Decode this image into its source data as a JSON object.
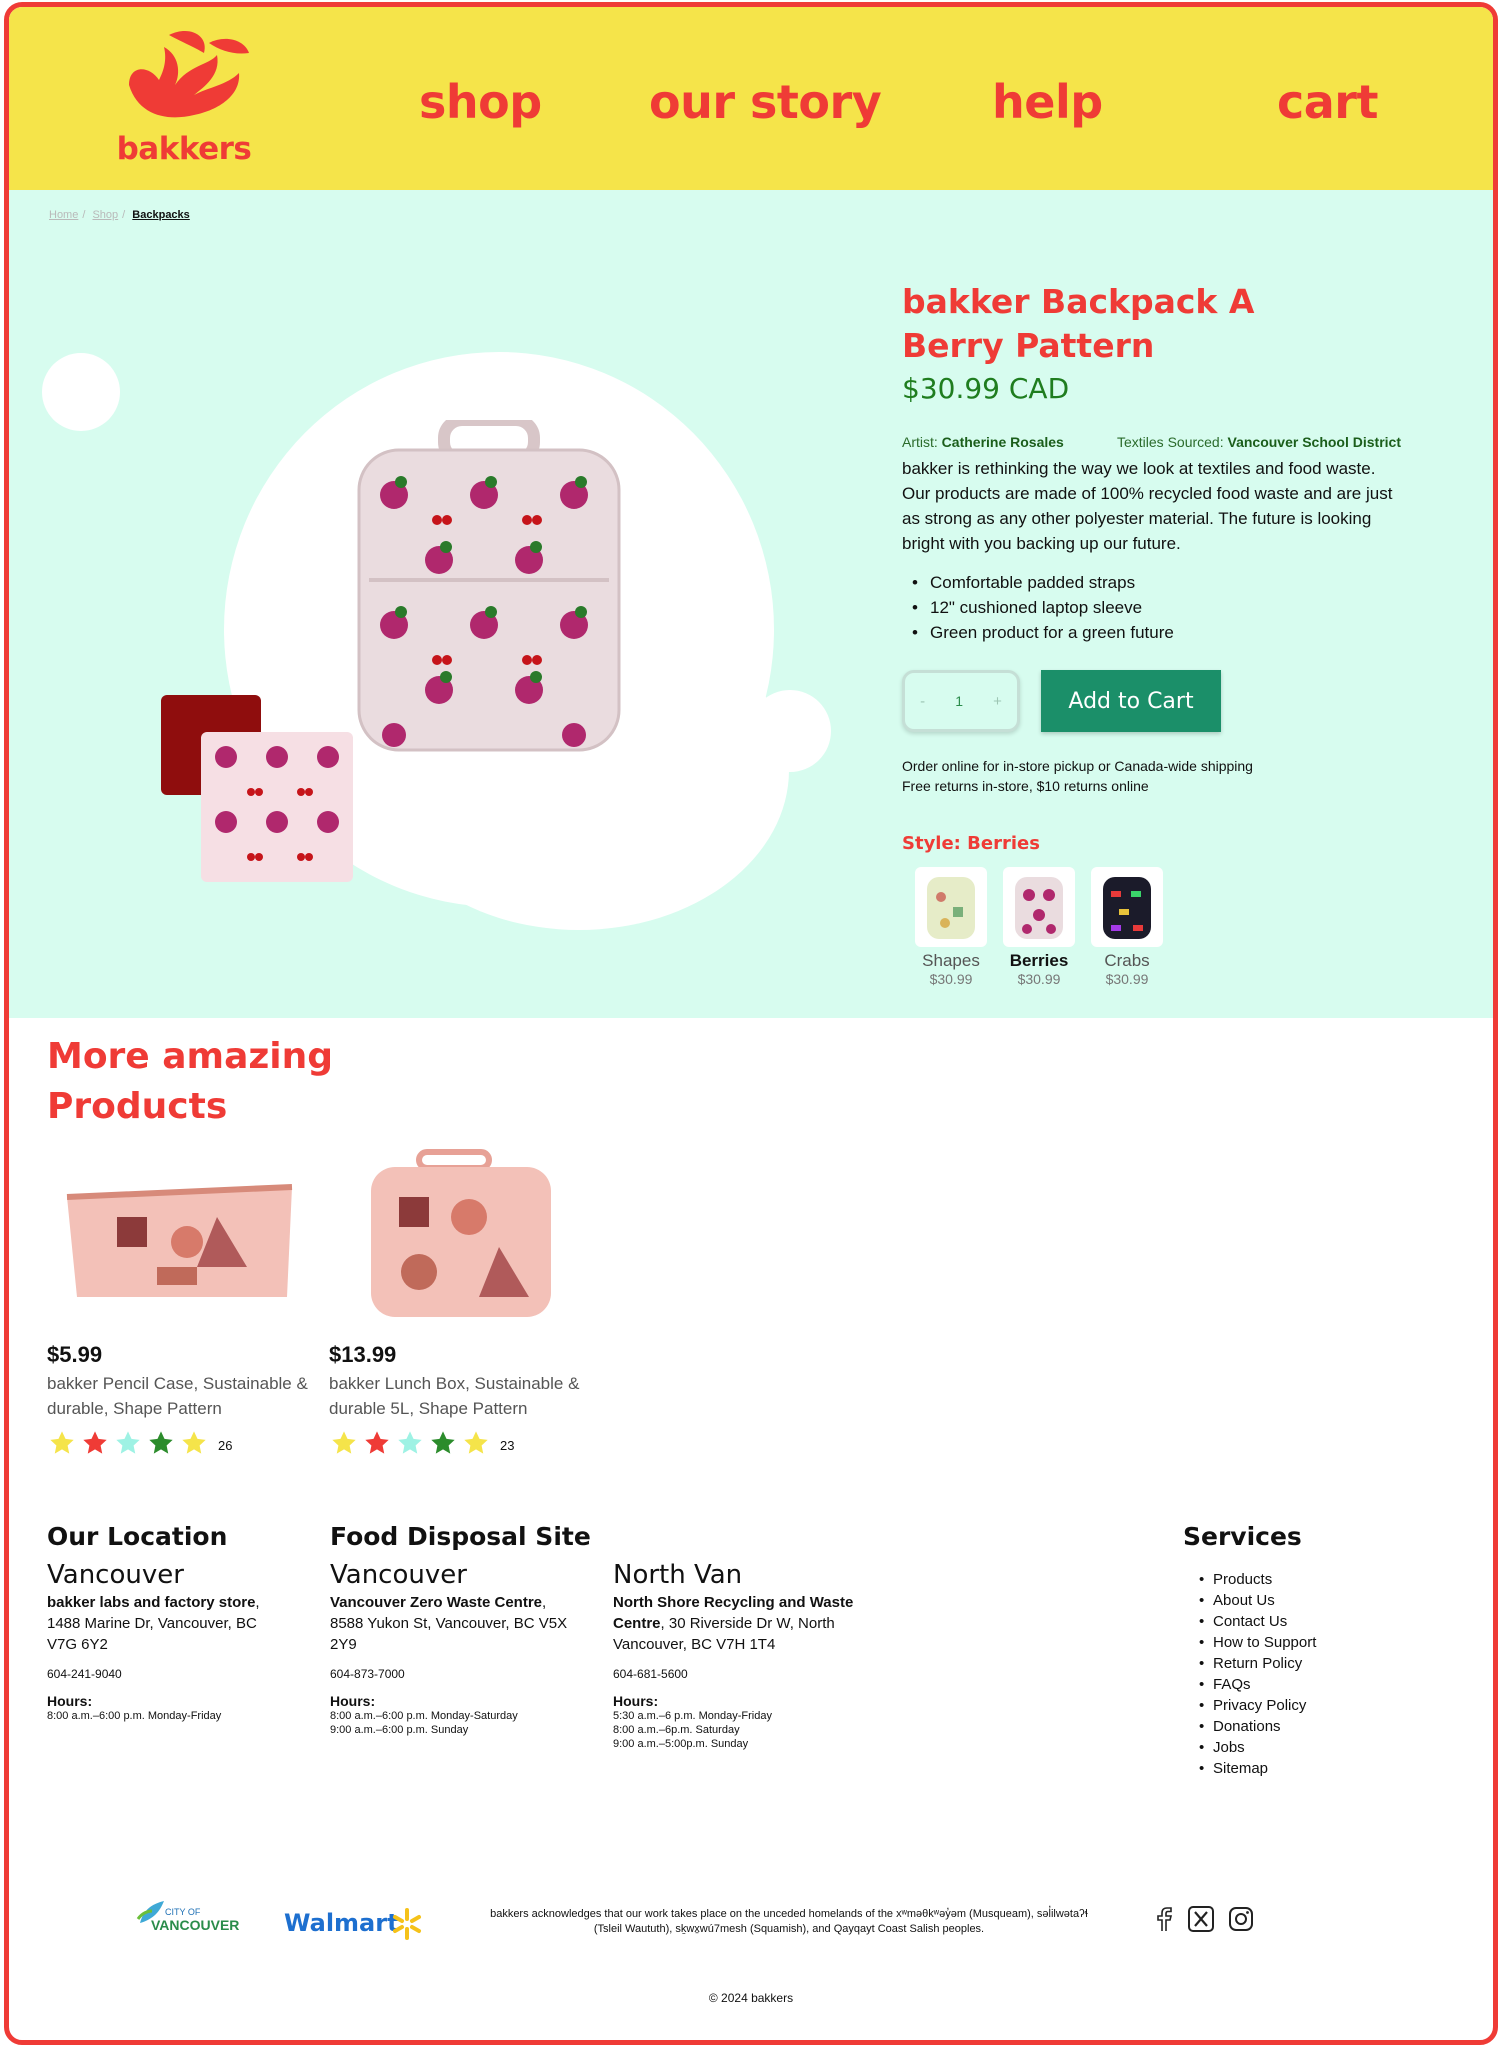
{
  "brand": {
    "name": "bakkers"
  },
  "nav": {
    "shop": "shop",
    "story": "our story",
    "help": "help",
    "cart": "cart"
  },
  "breadcrumb": [
    "Home",
    "Shop",
    "Backpacks"
  ],
  "product": {
    "title": "bakker Backpack A Berry Pattern",
    "price": "$30.99 CAD",
    "artist_label": "Artist:",
    "artist": "Catherine Rosales",
    "textiles_label": "Textiles Sourced:",
    "textiles": "Vancouver  School District",
    "description": "bakker is rethinking the way we look at textiles and food waste. Our products are made of 100% recycled food waste and are just as strong as any other polyester material. The future is looking bright with you backing up our future.",
    "features": [
      "Comfortable padded straps",
      "12\" cushioned laptop sleeve",
      "Green product for a green future"
    ],
    "quantity": "1",
    "qty_minus": "-",
    "qty_plus": "+",
    "add_to_cart": "Add to Cart",
    "shipping_1": "Order online for in-store pickup or Canada-wide shipping",
    "shipping_2": "Free returns in-store, $10 returns online",
    "style_label": "Style: Berries",
    "styles": [
      {
        "name": "Shapes",
        "price": "$30.99"
      },
      {
        "name": "Berries",
        "price": "$30.99"
      },
      {
        "name": "Crabs",
        "price": "$30.99"
      }
    ]
  },
  "more": {
    "title_1": "More amazing",
    "title_2": "Products",
    "items": [
      {
        "price": "$5.99",
        "name": "bakker Pencil Case, Sustainable & durable, Shape Pattern",
        "rating_count": "26"
      },
      {
        "price": "$13.99",
        "name": "bakker Lunch Box, Sustainable & durable 5L, Shape Pattern",
        "rating_count": "23"
      }
    ]
  },
  "footer": {
    "location_heading": "Our Location",
    "disposal_heading": "Food Disposal Site",
    "services_heading": "Services",
    "locations": [
      {
        "city": "Vancouver",
        "name": "bakker labs and factory store",
        "address": ", 1488 Marine Dr, Vancouver, BC V7G 6Y2",
        "phone": "604-241-9040",
        "hours_label": "Hours:",
        "hours": [
          "8:00 a.m.–6:00 p.m. Monday-Friday"
        ]
      },
      {
        "city": "Vancouver",
        "name": "Vancouver Zero Waste Centre",
        "address": ", 8588 Yukon St, Vancouver, BC V5X 2Y9",
        "phone": "604-873-7000",
        "hours_label": "Hours:",
        "hours": [
          "8:00 a.m.–6:00 p.m. Monday-Saturday",
          "9:00 a.m.–6:00 p.m. Sunday"
        ]
      },
      {
        "city": "North Van",
        "name": "North Shore Recycling and Waste Centre",
        "address": ", 30 Riverside Dr W, North Vancouver, BC V7H 1T4",
        "phone": "604-681-5600",
        "hours_label": "Hours:",
        "hours": [
          "5:30 a.m.–6 p.m. Monday-Friday",
          "8:00 a.m.–6p.m. Saturday",
          "9:00 a.m.–5:00p.m. Sunday"
        ]
      }
    ],
    "services": [
      "Products",
      "About Us",
      "Contact Us",
      "How to Support",
      "Return Policy",
      "FAQs",
      "Privacy Policy",
      "Donations",
      "Jobs",
      "Sitemap"
    ],
    "partner_city_1": "CITY OF",
    "partner_city_2": "VANCOUVER",
    "partner_walmart": "Walmart",
    "acknowledgement": "bakkers acknowledges that our work takes place on the unceded homelands of the xʷməθkʷəy̓əm (Musqueam), səl̓ilwətaʔɬ (Tsleil Waututh), sḵwx̱wú7mesh (Squamish), and Qayqayt Coast Salish peoples.",
    "copyright": "© 2024 bakkers"
  },
  "colors": {
    "red": "#ef3b36",
    "yellow": "#f5e44a",
    "mint": "#d7fcef",
    "green": "#1b8f69",
    "price_green": "#1f7d1f"
  },
  "icons": [
    "facebook-icon",
    "x-icon",
    "instagram-icon",
    "star-icon",
    "walmart-spark-icon"
  ]
}
